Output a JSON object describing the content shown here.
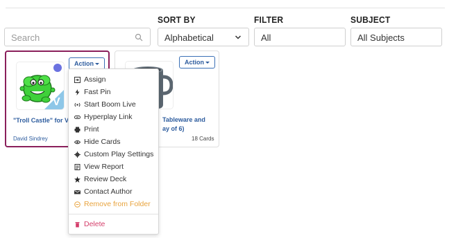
{
  "filters": {
    "search_placeholder": "Search",
    "sort_label": "SORT BY",
    "sort_value": "Alphabetical",
    "filter_label": "FILTER",
    "filter_value": "All",
    "subject_label": "SUBJECT",
    "subject_value": "All Subjects"
  },
  "cards": [
    {
      "action_label": "Action",
      "title": "\"Troll Castle\" for Vo",
      "author": "David Sindrey",
      "badge": "V"
    },
    {
      "action_label": "Action",
      "title_line1": "Tableware and",
      "title_line2": "ay of 6)",
      "count": "18 Cards"
    }
  ],
  "menu": {
    "items": [
      {
        "label": "Assign",
        "icon": "assign-icon"
      },
      {
        "label": "Fast Pin",
        "icon": "bolt-icon"
      },
      {
        "label": "Start Boom Live",
        "icon": "broadcast-icon"
      },
      {
        "label": "Hyperplay Link",
        "icon": "link-icon"
      },
      {
        "label": "Print",
        "icon": "print-icon"
      },
      {
        "label": "Hide Cards",
        "icon": "eye-icon"
      },
      {
        "label": "Custom Play Settings",
        "icon": "gear-icon"
      },
      {
        "label": "View Report",
        "icon": "report-icon"
      },
      {
        "label": "Review Deck",
        "icon": "star-icon"
      },
      {
        "label": "Contact Author",
        "icon": "envelope-icon"
      },
      {
        "label": "Remove from Folder",
        "icon": "minus-circle-icon"
      },
      {
        "label": "Delete",
        "icon": "trash-icon"
      }
    ]
  },
  "colors": {
    "accent_blue": "#2d5c9e",
    "selected_border": "#8a1f5b",
    "remove_orange": "#e8a33d",
    "delete_red": "#d43d6a"
  }
}
